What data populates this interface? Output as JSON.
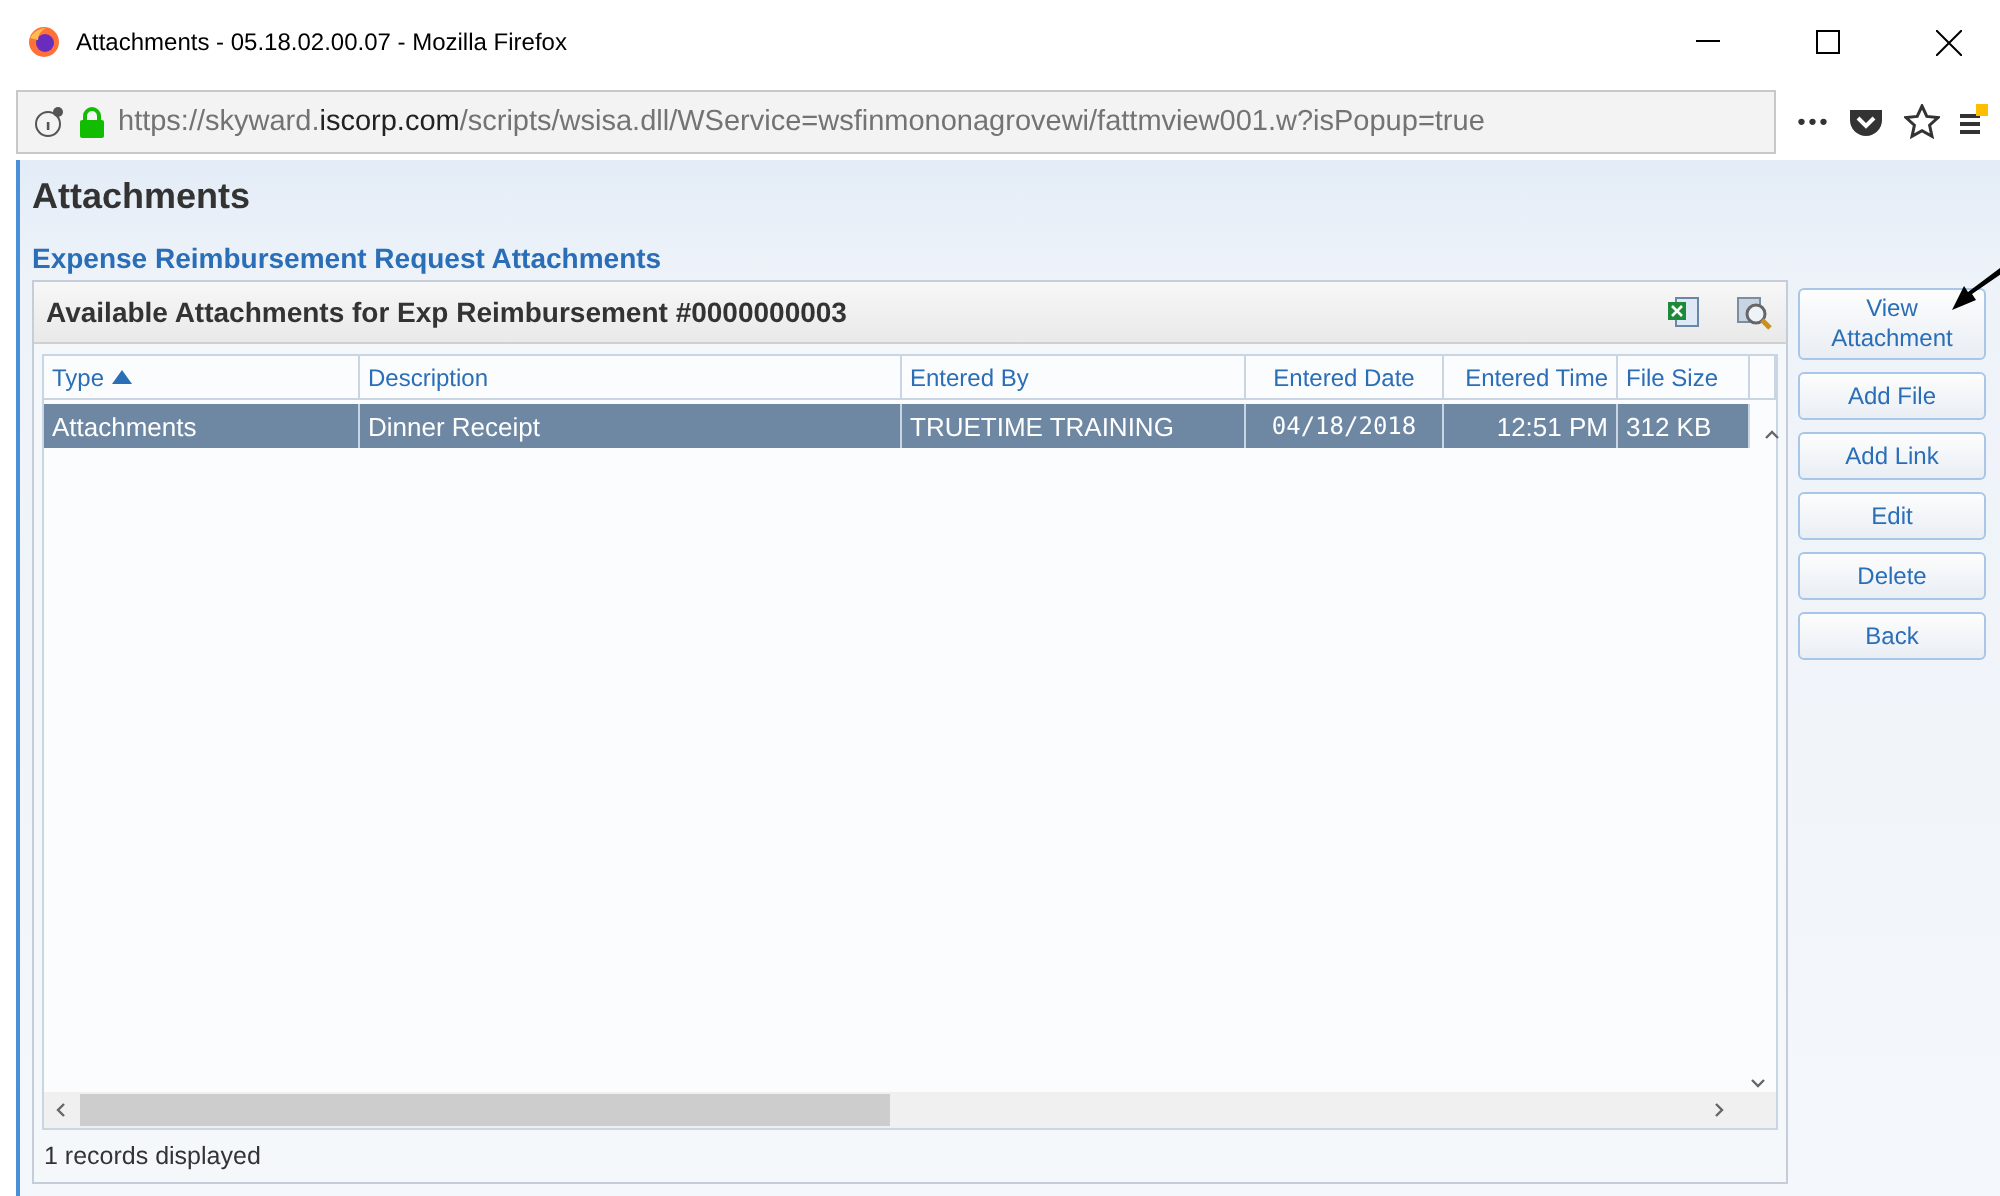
{
  "window": {
    "title": "Attachments - 05.18.02.00.07 - Mozilla Firefox"
  },
  "address_bar": {
    "url_prefix": "https://skyward.",
    "url_domain": "iscorp.com",
    "url_path": "/scripts/wsisa.dll/WService=wsfinmononagrovewi/fattmview001.w?isPopup=true",
    "menu_dots": "•••"
  },
  "page": {
    "title": "Attachments",
    "subtitle": "Expense Reimbursement Request Attachments"
  },
  "panel": {
    "title": "Available Attachments for Exp Reimbursement #0000000003",
    "columns": [
      {
        "label": "Type",
        "sorted": true
      },
      {
        "label": "Description",
        "sorted": false
      },
      {
        "label": "Entered By",
        "sorted": false
      },
      {
        "label": "Entered Date",
        "sorted": false
      },
      {
        "label": "Entered Time",
        "sorted": false
      },
      {
        "label": "File Size",
        "sorted": false
      }
    ],
    "rows": [
      {
        "selected": true,
        "cells": [
          "Attachments",
          "Dinner Receipt",
          "TRUETIME TRAINING",
          "04/18/2018",
          "12:51 PM",
          "312 KB"
        ]
      }
    ],
    "status": "1 records displayed"
  },
  "buttons": [
    {
      "label": "View Attachment"
    },
    {
      "label": "Add File"
    },
    {
      "label": "Add Link"
    },
    {
      "label": "Edit"
    },
    {
      "label": "Delete"
    },
    {
      "label": "Back"
    }
  ]
}
